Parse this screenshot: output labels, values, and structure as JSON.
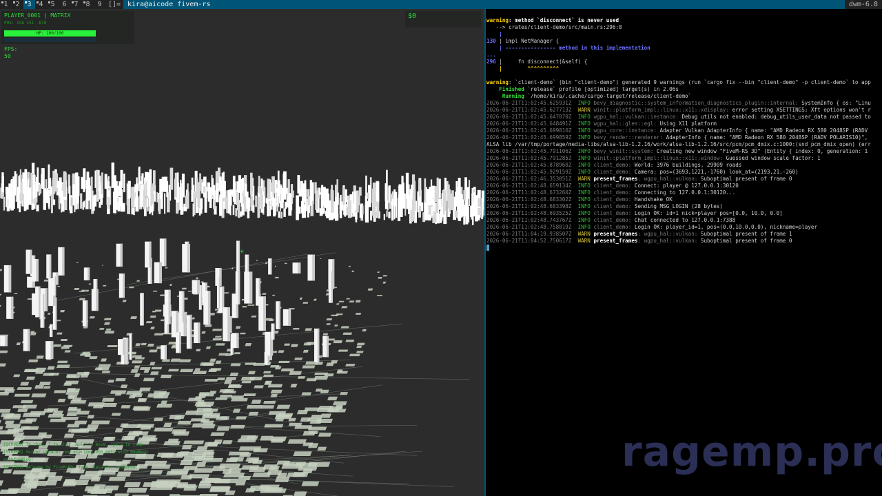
{
  "bar": {
    "tags": [
      "1",
      "2",
      "3",
      "4",
      "5",
      "6",
      "7",
      "8",
      "9"
    ],
    "selected_tag": "3",
    "occupied": [
      "1",
      "2",
      "3",
      "4",
      "5",
      "7",
      "8"
    ],
    "layout": "[]=",
    "title": "kira@aicode fivem-rs",
    "status": "dwm-6.8",
    "colors": {
      "bar_bg": "#222222",
      "sel_bg": "#005577",
      "fg": "#bbbbbb",
      "sel_fg": "#eeeeee"
    }
  },
  "game": {
    "player": "PLAYER_0001 | MATRIX",
    "pos": "POS: 158 151 -678",
    "hp": "HP: 100/100",
    "fps_label": "FPS:",
    "fps_value": "50",
    "money": "$0",
    "crosshair": "+",
    "chat": [
      "[SERVER] To chat, T to chat, hold to move, space to jump",
      "[SERVER] Server update: now starting 200 bots with NavMesh",
      "pathfinding!",
      "[SYSTEM] Welcome to FiveM-RS. Type /help for commands."
    ],
    "colors": {
      "hud_green": "#2fdc3a",
      "ground": "#2c2c2c",
      "buildings": "#ffffff"
    }
  },
  "terminal": {
    "lines": [
      [
        [
          "warning",
          "y"
        ],
        [
          ": method `disconnect` is never used",
          "b"
        ]
      ],
      [
        [
          "   --> crates/client-demo/src/main.rs:296:8",
          ""
        ]
      ],
      [
        [
          "    |",
          "blu"
        ]
      ],
      [
        [
          "130",
          "blu"
        ],
        [
          " | impl NetManager {",
          ""
        ]
      ],
      [
        [
          "    | ---------------- method in this implementation",
          "blu"
        ]
      ],
      [
        [
          "...",
          "blu"
        ]
      ],
      [
        [
          "296",
          "blu"
        ],
        [
          " |     fn disconnect(&self) {",
          ""
        ]
      ],
      [
        [
          "    |        ^^^^^^^^^^",
          "y"
        ]
      ],
      [
        [
          "",
          ""
        ]
      ],
      [
        [
          "warning",
          "y"
        ],
        [
          ": `client-demo` (bin \"client-demo\") generated 9 warnings (run `cargo fix --bin \"client-demo\" -p client-demo` to app",
          ""
        ]
      ],
      [
        [
          "    Finished",
          "g"
        ],
        [
          " `release` profile [optimized] target(s) in 2.06s",
          ""
        ]
      ],
      [
        [
          "     Running",
          "g"
        ],
        [
          " `/home/kira/.cache/cargo-target/release/client-demo`",
          ""
        ]
      ],
      [
        [
          "2026-06-21T11:02:45.625931Z",
          "ts"
        ],
        [
          "  INFO",
          "info"
        ],
        [
          " bevy_diagnostic::system_information_diagnostics_plugin::internal:",
          "mod"
        ],
        [
          " SystemInfo { os: \"Linu",
          ""
        ]
      ],
      [
        [
          "2026-06-21T11:02:45.627713Z",
          "ts"
        ],
        [
          "  WARN",
          "warn"
        ],
        [
          " winit::platform_impl::linux::x11::xdisplay:",
          "mod"
        ],
        [
          " error setting XSETTINGS; Xft options won't r",
          ""
        ]
      ],
      [
        [
          "2026-06-21T11:02:45.647070Z",
          "ts"
        ],
        [
          "  INFO",
          "info"
        ],
        [
          " wgpu_hal::vulkan::instance:",
          "mod"
        ],
        [
          " Debug utils not enabled: debug_utils_user_data not passed to",
          ""
        ]
      ],
      [
        [
          "2026-06-21T11:02:45.648491Z",
          "ts"
        ],
        [
          "  INFO",
          "info"
        ],
        [
          " wgpu_hal::gles::egl:",
          "mod"
        ],
        [
          " Using X11 platform",
          ""
        ]
      ],
      [
        [
          "2026-06-21T11:02:45.699816Z",
          "ts"
        ],
        [
          "  INFO",
          "info"
        ],
        [
          " wgpu_core::instance:",
          "mod"
        ],
        [
          " Adapter Vulkan AdapterInfo { name: \"AMD Radeon RX 580 2048SP (RADV",
          ""
        ]
      ],
      [
        [
          "2026-06-21T11:02:45.699859Z",
          "ts"
        ],
        [
          "  INFO",
          "info"
        ],
        [
          " bevy_render::renderer:",
          "mod"
        ],
        [
          " AdapterInfo { name: \"AMD Radeon RX 580 2048SP (RADV POLARIS10)\",",
          ""
        ]
      ],
      [
        [
          "ALSA lib /var/tmp/portage/media-libs/alsa-lib-1.2.16/work/alsa-lib-1.2.16/src/pcm/pcm_dmix.c:1000:(snd_pcm_dmix_open) (err",
          ""
        ]
      ],
      [
        [
          "2026-06-21T11:02:45.791106Z",
          "ts"
        ],
        [
          "  INFO",
          "info"
        ],
        [
          " bevy_winit::system:",
          "mod"
        ],
        [
          " Creating new window \"FiveM-RS 3D\" (Entity { index: 0, generation: 1",
          ""
        ]
      ],
      [
        [
          "2026-06-21T11:02:45.791285Z",
          "ts"
        ],
        [
          "  INFO",
          "info"
        ],
        [
          " winit::platform_impl::linux::x11::window:",
          "mod"
        ],
        [
          " Guessed window scale factor: 1",
          ""
        ]
      ],
      [
        [
          "2026-06-21T11:02:45.878960Z",
          "ts"
        ],
        [
          "  INFO",
          "info"
        ],
        [
          " client_demo:",
          "mod"
        ],
        [
          " World: 3976 buildings, 29909 roads",
          ""
        ]
      ],
      [
        [
          "2026-06-21T11:02:45.929159Z",
          "ts"
        ],
        [
          "  INFO",
          "info"
        ],
        [
          " client_demo:",
          "mod"
        ],
        [
          " Camera: pos=(3693,1221,-1760) look_at=(2193,21,-260)",
          ""
        ]
      ],
      [
        [
          "2026-06-21T11:02:46.353051Z",
          "ts"
        ],
        [
          "  WARN",
          "warn"
        ],
        [
          " present_frames",
          "b"
        ],
        [
          ": wgpu_hal::vulkan:",
          "mod"
        ],
        [
          " Suboptimal present of frame 0",
          ""
        ]
      ],
      [
        [
          "2026-06-21T11:02:48.659134Z",
          "ts"
        ],
        [
          "  INFO",
          "info"
        ],
        [
          " client_demo:",
          "mod"
        ],
        [
          " Connect: player @ 127.0.0.1:30120",
          ""
        ]
      ],
      [
        [
          "2026-06-21T11:02:48.673260Z",
          "ts"
        ],
        [
          "  INFO",
          "info"
        ],
        [
          " client_demo:",
          "mod"
        ],
        [
          " Connecting to 127.0.0.1:30120...",
          ""
        ]
      ],
      [
        [
          "2026-06-21T11:02:48.683302Z",
          "ts"
        ],
        [
          "  INFO",
          "info"
        ],
        [
          " client_demo:",
          "mod"
        ],
        [
          " Handshake OK",
          ""
        ]
      ],
      [
        [
          "2026-06-21T11:02:48.683398Z",
          "ts"
        ],
        [
          "  INFO",
          "info"
        ],
        [
          " client_demo:",
          "mod"
        ],
        [
          " Sending MSG_LOGIN (28 bytes)",
          ""
        ]
      ],
      [
        [
          "2026-06-21T11:02:48.693525Z",
          "ts"
        ],
        [
          "  INFO",
          "info"
        ],
        [
          " client_demo:",
          "mod"
        ],
        [
          " Login OK: id=1 nick=player pos=[0.0, 10.0, 0.0]",
          ""
        ]
      ],
      [
        [
          "2026-06-21T11:02:48.743767Z",
          "ts"
        ],
        [
          "  INFO",
          "info"
        ],
        [
          " client_demo:",
          "mod"
        ],
        [
          " Chat connected to 127.0.0.1:7388",
          ""
        ]
      ],
      [
        [
          "2026-06-21T11:02:48.758819Z",
          "ts"
        ],
        [
          "  INFO",
          "info"
        ],
        [
          " client_demo:",
          "mod"
        ],
        [
          " Login OK: player_id=1, pos=(0.0,10.0,0.0), nickname=player",
          ""
        ]
      ],
      [
        [
          "2026-06-21T11:04:19.938507Z",
          "ts"
        ],
        [
          "  WARN",
          "warn"
        ],
        [
          " present_frames",
          "b"
        ],
        [
          ": wgpu_hal::vulkan:",
          "mod"
        ],
        [
          " Suboptimal present of frame 1",
          ""
        ]
      ],
      [
        [
          "2026-06-21T11:04:52.750617Z",
          "ts"
        ],
        [
          "  WARN",
          "warn"
        ],
        [
          " present_frames",
          "b"
        ],
        [
          ": wgpu_hal::vulkan:",
          "mod"
        ],
        [
          " Suboptimal present of frame 0",
          ""
        ]
      ]
    ]
  },
  "watermark": "ragemp.pro"
}
